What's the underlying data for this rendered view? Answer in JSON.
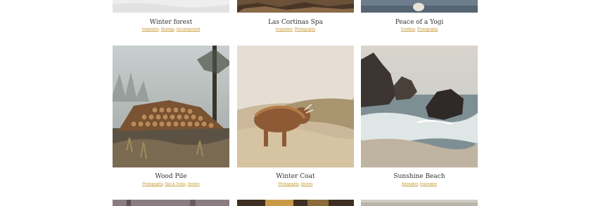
{
  "rows": [
    {
      "tiles": [
        {
          "title": "Winter forest",
          "categories": [
            "Inspiration",
            "Musings",
            "Uncategorized"
          ]
        },
        {
          "title": "Las Cortinas Spa",
          "categories": [
            "Inspiration",
            "Photography"
          ]
        },
        {
          "title": "Peace of a Yogi",
          "categories": [
            "Freebies",
            "Photography"
          ]
        }
      ]
    },
    {
      "tiles": [
        {
          "title": "Wood Pile",
          "categories": [
            "Photography",
            "Tips & Tricks",
            "Vectors"
          ]
        },
        {
          "title": "Winter Coat",
          "categories": [
            "Photography",
            "Vectors"
          ]
        },
        {
          "title": "Sunshine Beach",
          "categories": [
            "Animation",
            "Inspiration"
          ]
        }
      ]
    }
  ],
  "colors": {
    "category_link": "#c79a33",
    "title_text": "#333333"
  }
}
